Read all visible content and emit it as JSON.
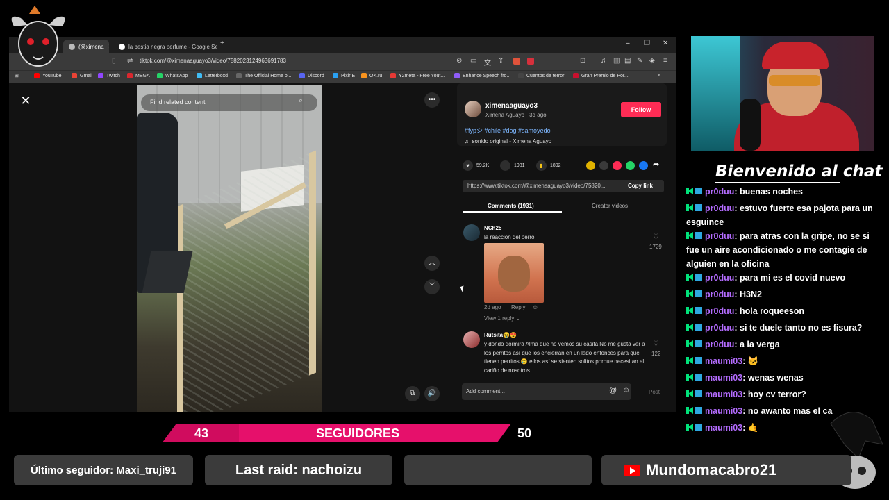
{
  "browser": {
    "tabs": [
      {
        "label": "(@ximena"
      },
      {
        "label": "la bestia negra perfume - Google Se"
      }
    ],
    "url": "tiktok.com/@ximenaaguayo3/video/7582023124963691783",
    "bookmarks": [
      "YouTube",
      "Gmail",
      "Twitch",
      "MEGA",
      "WhatsApp",
      "Letterboxd",
      "The Official Home o...",
      "Discord",
      "Pixlr E",
      "OK.ru",
      "Y2meta - Free Yout...",
      "Enhance Speech fro...",
      "Cuentos de terror",
      "Gran Premio de Por..."
    ]
  },
  "video": {
    "search_placeholder": "Find related content"
  },
  "post": {
    "username": "ximenaaguayo3",
    "display_and_time": "Ximena Aguayo · 3d ago",
    "follow_label": "Follow",
    "hashtags": "#fypシ #chile #dog #samoyedo",
    "sound": "sonido original - Ximena Aguayo",
    "likes": "59.2K",
    "comments_count": "1931",
    "saves": "1892",
    "link": "https://www.tiktok.com/@ximenaaguayo3/video/75820...",
    "copy_link": "Copy link",
    "tab_comments": "Comments (1931)",
    "tab_creator": "Creator videos"
  },
  "comments": [
    {
      "user": "NCh25",
      "text": "la reacción del perro",
      "likes": "1729",
      "date": "2d ago",
      "reply": "Reply",
      "view_replies": "View 1 reply"
    },
    {
      "user": "Rutsita🤤😍",
      "text": "y dondo dormirá Alma que no vemos su casita No me gusta ver a los perritos así que los encierran en un lado entonces para que tienen perritos 🥲 ellos así se sienten solitos porque necesitan el cariño de nosotros",
      "likes": "122"
    }
  ],
  "composer": {
    "placeholder": "Add comment...",
    "post_label": "Post"
  },
  "chat": {
    "title": "Bienvenido al chat",
    "messages": [
      {
        "user": "pr0duu",
        "text": ": buenas noches"
      },
      {
        "user": "pr0duu",
        "text": ": estuvo fuerte esa pajota para un esguince"
      },
      {
        "user": "pr0duu",
        "text": ": para atras con la gripe, no se si fue un aire acondicionado o me contagie de alguien en la oficina"
      },
      {
        "user": "pr0duu",
        "text": ": para mi es el covid nuevo"
      },
      {
        "user": "pr0duu",
        "text": ": H3N2"
      },
      {
        "user": "pr0duu",
        "text": ": hola roqueeson"
      },
      {
        "user": "pr0duu",
        "text": ": si te duele tanto no es fisura?"
      },
      {
        "user": "pr0duu",
        "text": ": a la verga"
      },
      {
        "user": "maumi03",
        "text": ": 🐱"
      },
      {
        "user": "maumi03",
        "text": ": wenas wenas"
      },
      {
        "user": "maumi03",
        "text": ": hoy cv terror?"
      },
      {
        "user": "maumi03",
        "text": ": no awanto mas el ca"
      },
      {
        "user": "maumi03",
        "text": ": 🤙"
      }
    ]
  },
  "overlay": {
    "followers_current": "43",
    "followers_label": "SEGUIDORES",
    "followers_goal": "50",
    "last_follower": "Último seguidor: Maxi_truji91",
    "last_raid": "Last raid: nachoizu",
    "empty_panel": "",
    "youtube_channel": "Mundomacabro21"
  },
  "colors": {
    "accent": "#fe2c55",
    "goal_bar": "#e6106b",
    "chat_user": "#b46cff",
    "hashtag": "#7db7ff"
  }
}
